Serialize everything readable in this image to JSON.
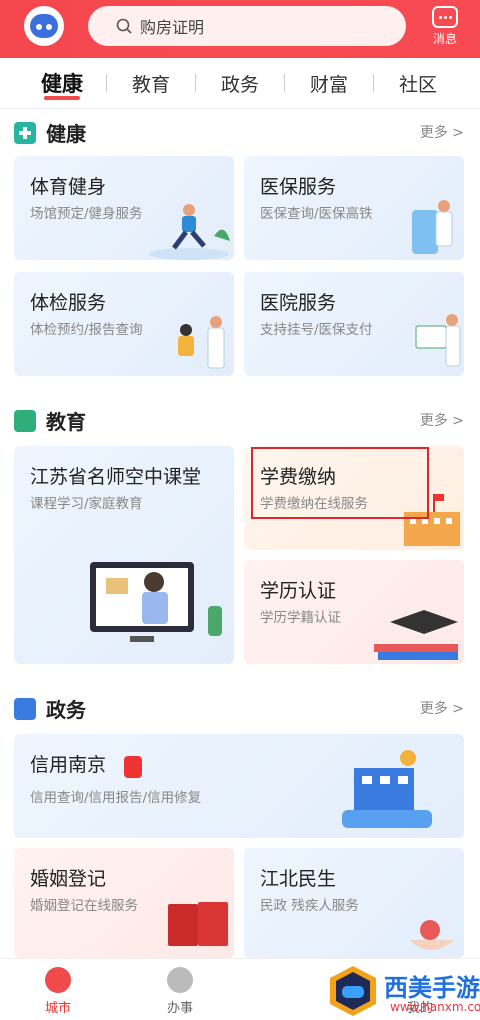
{
  "header": {
    "search_placeholder": "购房证明",
    "message_label": "消息"
  },
  "tabs": [
    "健康",
    "教育",
    "政务",
    "财富",
    "社区"
  ],
  "sections": {
    "health": {
      "title": "健康",
      "more": "更多 >",
      "cards": [
        {
          "title": "体育健身",
          "sub": "场馆预定/健身服务"
        },
        {
          "title": "医保服务",
          "sub": "医保查询/医保高铁"
        },
        {
          "title": "体检服务",
          "sub": "体检预约/报告查询"
        },
        {
          "title": "医院服务",
          "sub": "支持挂号/医保支付"
        }
      ]
    },
    "education": {
      "title": "教育",
      "more": "更多 >",
      "cards": [
        {
          "title": "江苏省名师空中课堂",
          "sub": "课程学习/家庭教育"
        },
        {
          "title": "学费缴纳",
          "sub": "学费缴纳在线服务"
        },
        {
          "title": "学历认证",
          "sub": "学历学籍认证"
        }
      ]
    },
    "gov": {
      "title": "政务",
      "more": "更多 >",
      "cards": [
        {
          "title": "信用南京",
          "sub": "信用查询/信用报告/信用修复"
        },
        {
          "title": "婚姻登记",
          "sub": "婚姻登记在线服务"
        },
        {
          "title": "江北民生",
          "sub": "民政 残疾人服务"
        }
      ]
    }
  },
  "bottom_nav": [
    "城市",
    "办事",
    "我的"
  ],
  "watermark": {
    "text": "西美手游网",
    "url": "www.hanxm.com"
  },
  "colors": {
    "brand": "#f5484e",
    "icon_blue": "#3a7be0"
  }
}
